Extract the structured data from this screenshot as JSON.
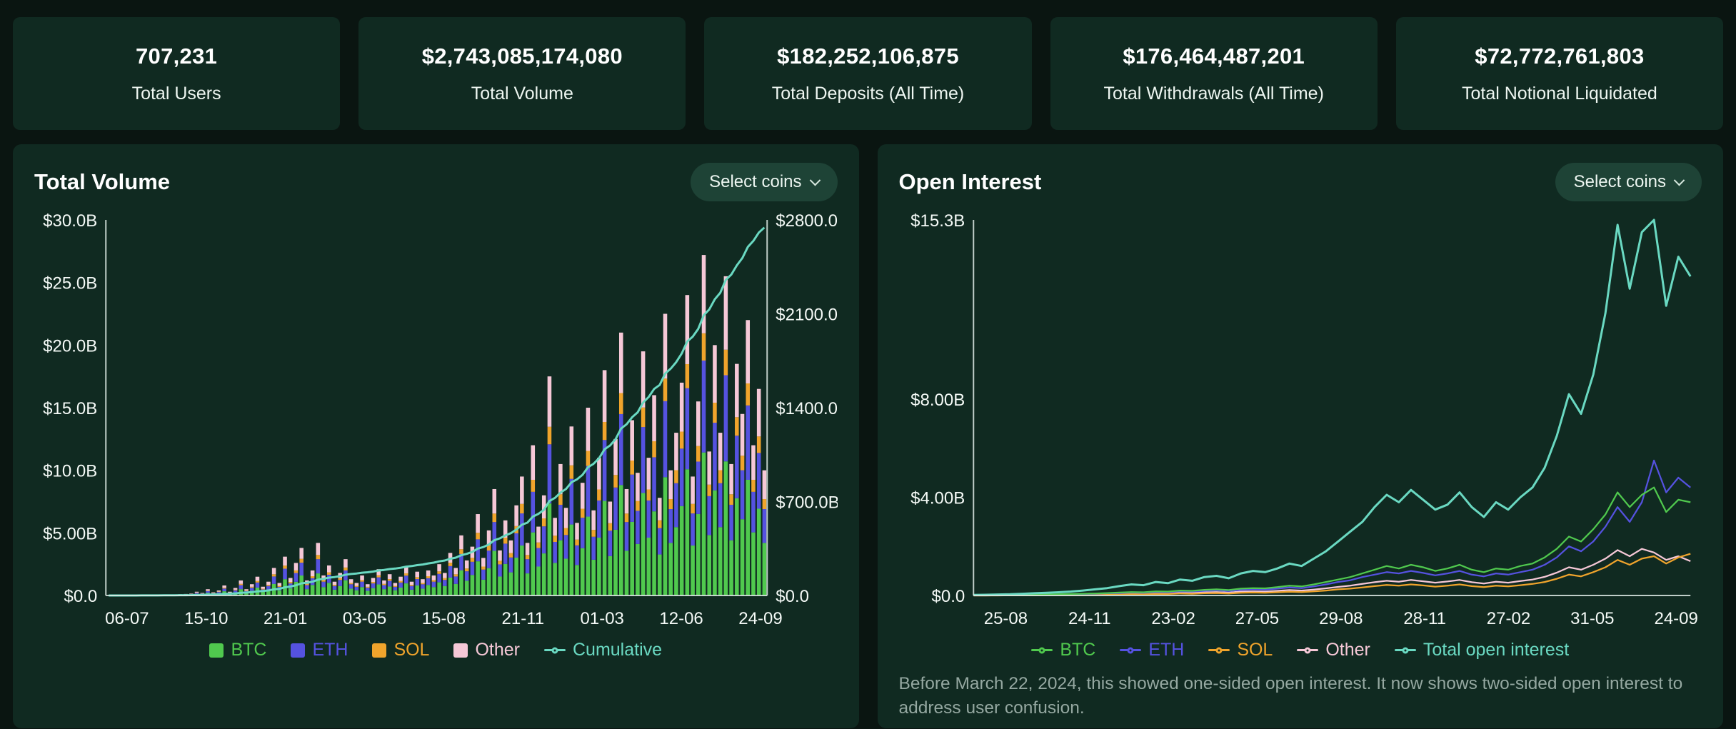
{
  "stats": [
    {
      "value": "707,231",
      "label": "Total Users"
    },
    {
      "value": "$2,743,085,174,080",
      "label": "Total Volume"
    },
    {
      "value": "$182,252,106,875",
      "label": "Total Deposits (All Time)"
    },
    {
      "value": "$176,464,487,201",
      "label": "Total Withdrawals (All Time)"
    },
    {
      "value": "$72,772,761,803",
      "label": "Total Notional Liquidated"
    }
  ],
  "panels": {
    "volume": {
      "title": "Total Volume",
      "select_coins": "Select coins"
    },
    "open_interest": {
      "title": "Open Interest",
      "select_coins": "Select coins",
      "footnote": "Before March 22, 2024, this showed one-sided open interest. It now shows two-sided open interest to address user confusion."
    }
  },
  "colors": {
    "background": "#0a1511",
    "panel": "#102a21",
    "pill": "#1e4336",
    "accent": "#6ad9c2",
    "text": "#ffffff",
    "muted_text": "#95a8a1",
    "axis": "#dfeae5"
  },
  "chart_data": [
    {
      "id": "total-volume",
      "type": "bar",
      "title": "Total Volume",
      "xlabel": "",
      "ylabel": "",
      "grid": false,
      "legend_position": "bottom",
      "x_tick_labels": [
        "06-07",
        "15-10",
        "21-01",
        "03-05",
        "15-08",
        "21-11",
        "01-03",
        "12-06",
        "24-09"
      ],
      "y_left_ticks": [
        {
          "label": "$0.0",
          "value": 0
        },
        {
          "label": "$5.00B",
          "value": 5
        },
        {
          "label": "$10.0B",
          "value": 10
        },
        {
          "label": "$15.0B",
          "value": 15
        },
        {
          "label": "$20.0B",
          "value": 20
        },
        {
          "label": "$25.0B",
          "value": 25
        },
        {
          "label": "$30.0B",
          "value": 30
        }
      ],
      "y_left_max": 30,
      "y_right_ticks": [
        {
          "label": "$0.0",
          "value": 0
        },
        {
          "label": "$700.0B",
          "value": 700
        },
        {
          "label": "$1400.0",
          "value": 1400
        },
        {
          "label": "$2100.0",
          "value": 2100
        },
        {
          "label": "$2800.0",
          "value": 2800
        }
      ],
      "y_right_max": 2800,
      "unit": "USD billions (daily bars left axis, cumulative right axis)",
      "stacked_series": [
        {
          "name": "BTC",
          "color": "#50c94e",
          "fraction": 0.42
        },
        {
          "name": "ETH",
          "color": "#5552e0",
          "fraction": 0.27
        },
        {
          "name": "SOL",
          "color": "#f0a42c",
          "fraction": 0.08
        },
        {
          "name": "Other",
          "color": "#f6c8d7",
          "fraction": 0.23
        }
      ],
      "total_daily_volume_B": [
        0,
        0,
        0.01,
        0.01,
        0.02,
        0.02,
        0.03,
        0.03,
        0.04,
        0.05,
        0.05,
        0.06,
        0.08,
        0.1,
        0.12,
        0.15,
        0.3,
        0.2,
        0.5,
        0.25,
        0.4,
        0.8,
        0.3,
        0.6,
        1.2,
        0.5,
        0.9,
        1.5,
        0.7,
        1.1,
        2.2,
        1,
        3.1,
        1.4,
        2.6,
        3.8,
        1.2,
        2,
        4.2,
        1.6,
        2.4,
        1.1,
        1.8,
        2.9,
        1.3,
        1,
        1.6,
        0.9,
        1.4,
        2.1,
        1.2,
        1.7,
        1,
        1.5,
        2.3,
        1.1,
        1.9,
        1.3,
        2,
        1.6,
        2.5,
        1.8,
        3.4,
        2.2,
        4.8,
        2.8,
        3.9,
        6.5,
        3,
        5.2,
        8.5,
        3.6,
        6,
        4.4,
        7.2,
        9.5,
        4.2,
        12,
        5.5,
        8,
        17.5,
        6.2,
        10.5,
        7,
        13.5,
        5.8,
        9,
        15,
        6.8,
        11,
        18,
        7.5,
        12.5,
        21,
        8.5,
        14,
        9.8,
        19.5,
        11,
        16,
        7.8,
        22.5,
        10,
        13,
        17,
        24,
        9.5,
        15.5,
        27.2,
        11.5,
        20,
        13,
        25.5,
        10.5,
        18.5,
        14.5,
        22,
        12,
        16.5,
        10
      ],
      "cumulative": {
        "name": "Cumulative",
        "color": "#6ad9c2",
        "final_B": 2743.09
      },
      "legend": [
        {
          "label": "BTC",
          "color": "#50c94e",
          "marker": "square"
        },
        {
          "label": "ETH",
          "color": "#5552e0",
          "marker": "square"
        },
        {
          "label": "SOL",
          "color": "#f0a42c",
          "marker": "square"
        },
        {
          "label": "Other",
          "color": "#f6c8d7",
          "marker": "square"
        },
        {
          "label": "Cumulative",
          "color": "#6ad9c2",
          "marker": "line-dot"
        }
      ]
    },
    {
      "id": "open-interest",
      "type": "line",
      "title": "Open Interest",
      "xlabel": "",
      "ylabel": "",
      "grid": false,
      "legend_position": "bottom",
      "x_tick_labels": [
        "25-08",
        "24-11",
        "23-02",
        "27-05",
        "29-08",
        "28-11",
        "27-02",
        "31-05",
        "24-09"
      ],
      "y_ticks": [
        {
          "label": "$0.0",
          "value": 0
        },
        {
          "label": "$4.00B",
          "value": 4
        },
        {
          "label": "$8.00B",
          "value": 8
        },
        {
          "label": "$15.3B",
          "value": 15.3
        }
      ],
      "y_max": 15.3,
      "ylim": [
        0,
        15.3
      ],
      "unit": "USD billions",
      "series": [
        {
          "name": "Other",
          "color": "#f6c8d7",
          "values": [
            0,
            0,
            0.01,
            0.01,
            0.01,
            0.02,
            0.02,
            0.03,
            0.03,
            0.04,
            0.05,
            0.06,
            0.07,
            0.08,
            0.08,
            0.1,
            0.09,
            0.12,
            0.11,
            0.13,
            0.14,
            0.12,
            0.16,
            0.17,
            0.16,
            0.19,
            0.22,
            0.2,
            0.24,
            0.29,
            0.35,
            0.4,
            0.47,
            0.54,
            0.6,
            0.56,
            0.63,
            0.58,
            0.52,
            0.57,
            0.63,
            0.54,
            0.49,
            0.56,
            0.52,
            0.59,
            0.65,
            0.76,
            0.93,
            1.15,
            1.05,
            1.25,
            1.5,
            1.85,
            1.6,
            1.9,
            1.75,
            1.45,
            1.6,
            1.4
          ]
        },
        {
          "name": "SOL",
          "color": "#f0a42c",
          "values": [
            0,
            0,
            0,
            0.01,
            0.01,
            0.01,
            0.02,
            0.02,
            0.02,
            0.03,
            0.03,
            0.04,
            0.05,
            0.05,
            0.05,
            0.06,
            0.06,
            0.08,
            0.07,
            0.09,
            0.1,
            0.08,
            0.11,
            0.12,
            0.11,
            0.13,
            0.15,
            0.14,
            0.17,
            0.2,
            0.25,
            0.28,
            0.33,
            0.38,
            0.43,
            0.4,
            0.45,
            0.41,
            0.36,
            0.4,
            0.45,
            0.38,
            0.34,
            0.4,
            0.37,
            0.42,
            0.47,
            0.55,
            0.68,
            0.85,
            0.78,
            0.95,
            1.15,
            1.45,
            1.25,
            1.5,
            1.6,
            1.3,
            1.55,
            1.7
          ]
        },
        {
          "name": "ETH",
          "color": "#5552e0",
          "values": [
            0.01,
            0.01,
            0.01,
            0.02,
            0.02,
            0.03,
            0.03,
            0.04,
            0.05,
            0.06,
            0.07,
            0.09,
            0.1,
            0.12,
            0.11,
            0.14,
            0.13,
            0.17,
            0.16,
            0.19,
            0.21,
            0.18,
            0.23,
            0.25,
            0.24,
            0.28,
            0.33,
            0.3,
            0.37,
            0.45,
            0.55,
            0.62,
            0.75,
            0.85,
            0.95,
            0.9,
            1,
            0.92,
            0.82,
            0.9,
            1,
            0.85,
            0.78,
            0.9,
            0.85,
            0.95,
            1.05,
            1.25,
            1.55,
            2,
            1.8,
            2.2,
            2.8,
            3.6,
            3,
            3.8,
            5.5,
            4.2,
            4.8,
            4.4
          ]
        },
        {
          "name": "BTC",
          "color": "#50c94e",
          "values": [
            0.01,
            0.01,
            0.02,
            0.02,
            0.03,
            0.03,
            0.04,
            0.05,
            0.06,
            0.07,
            0.08,
            0.1,
            0.12,
            0.14,
            0.13,
            0.17,
            0.16,
            0.2,
            0.19,
            0.23,
            0.25,
            0.22,
            0.28,
            0.3,
            0.29,
            0.34,
            0.4,
            0.37,
            0.45,
            0.55,
            0.65,
            0.75,
            0.9,
            1.05,
            1.2,
            1.1,
            1.25,
            1.15,
            1,
            1.1,
            1.25,
            1.05,
            0.95,
            1.1,
            1.05,
            1.2,
            1.3,
            1.55,
            1.9,
            2.4,
            2.2,
            2.7,
            3.3,
            4.2,
            3.6,
            4.1,
            4.4,
            3.4,
            3.9,
            3.8
          ]
        },
        {
          "name": "Total open interest",
          "color": "#6ad9c2",
          "values": [
            0.02,
            0.03,
            0.04,
            0.05,
            0.07,
            0.09,
            0.11,
            0.13,
            0.16,
            0.2,
            0.25,
            0.3,
            0.38,
            0.45,
            0.42,
            0.55,
            0.5,
            0.65,
            0.6,
            0.75,
            0.8,
            0.7,
            0.9,
            1,
            0.95,
            1.1,
            1.3,
            1.2,
            1.5,
            1.8,
            2.2,
            2.6,
            3,
            3.6,
            4.1,
            3.8,
            4.3,
            3.9,
            3.5,
            3.7,
            4.2,
            3.6,
            3.2,
            3.8,
            3.5,
            4,
            4.4,
            5.2,
            6.5,
            8.2,
            7.4,
            9,
            11.5,
            15.1,
            12.5,
            14.8,
            15.3,
            11.8,
            13.8,
            13
          ]
        }
      ],
      "legend": [
        {
          "label": "BTC",
          "color": "#50c94e",
          "marker": "line-dot"
        },
        {
          "label": "ETH",
          "color": "#5552e0",
          "marker": "line-dot"
        },
        {
          "label": "SOL",
          "color": "#f0a42c",
          "marker": "line-dot"
        },
        {
          "label": "Other",
          "color": "#f6c8d7",
          "marker": "line-dot"
        },
        {
          "label": "Total open interest",
          "color": "#6ad9c2",
          "marker": "line-dot"
        }
      ]
    }
  ]
}
